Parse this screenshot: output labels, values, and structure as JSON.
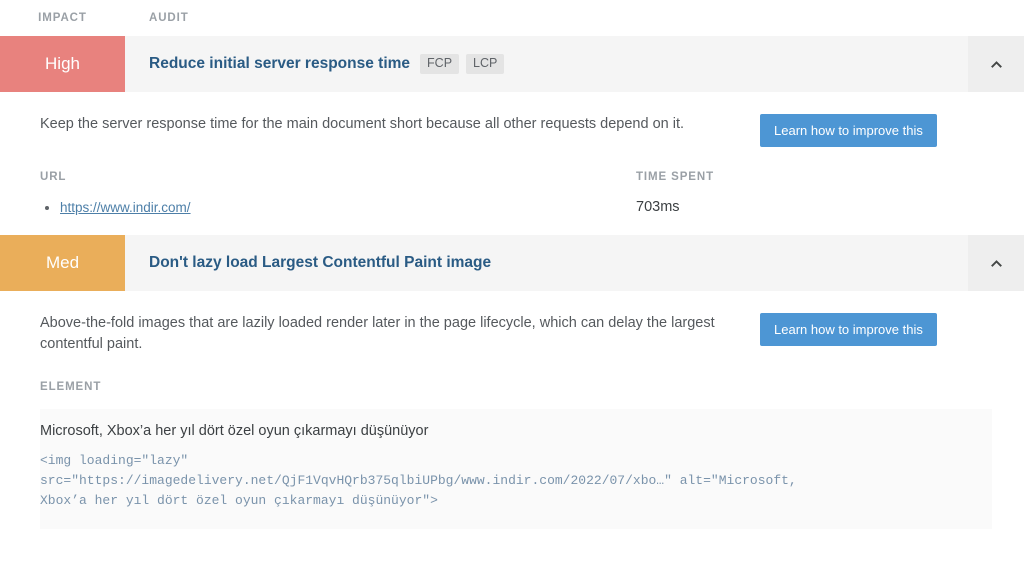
{
  "columns": {
    "impact": "IMPACT",
    "audit": "AUDIT"
  },
  "colors": {
    "impact_high": "#e8827e",
    "impact_med": "#eaae5a",
    "title_link": "#2a5b84",
    "learn_button": "#4d96d4",
    "pill_background": "#e4e4e4",
    "header_row_background": "#f5f5f5"
  },
  "audits": [
    {
      "impact_label": "High",
      "impact_level": "high",
      "title": "Reduce initial server response time",
      "metrics": [
        "FCP",
        "LCP"
      ],
      "collapse_icon": "chevron-up-icon",
      "description": "Keep the server response time for the main document short because all other requests depend on it.",
      "learn_more_label": "Learn how to improve this",
      "details": {
        "url_header": "URL",
        "urls": [
          "https://www.indir.com/"
        ],
        "time_header": "TIME SPENT",
        "time_value": "703ms"
      }
    },
    {
      "impact_label": "Med",
      "impact_level": "med",
      "title": "Don't lazy load Largest Contentful Paint image",
      "metrics": [],
      "collapse_icon": "chevron-up-icon",
      "description": "Above-the-fold images that are lazily loaded render later in the page lifecycle, which can delay the largest contentful paint.",
      "learn_more_label": "Learn how to improve this",
      "element": {
        "header": "ELEMENT",
        "caption": "Microsoft, Xbox’a her yıl dört özel oyun çıkarmayı düşünüyor",
        "code": "<img loading=\"lazy\"\nsrc=\"https://imagedelivery.net/QjF1VqvHQrb375qlbiUPbg/www.indir.com/2022/07/xbo…\" alt=\"Microsoft,\nXbox’a her yıl dört özel oyun çıkarmayı düşünüyor\">"
      }
    }
  ]
}
